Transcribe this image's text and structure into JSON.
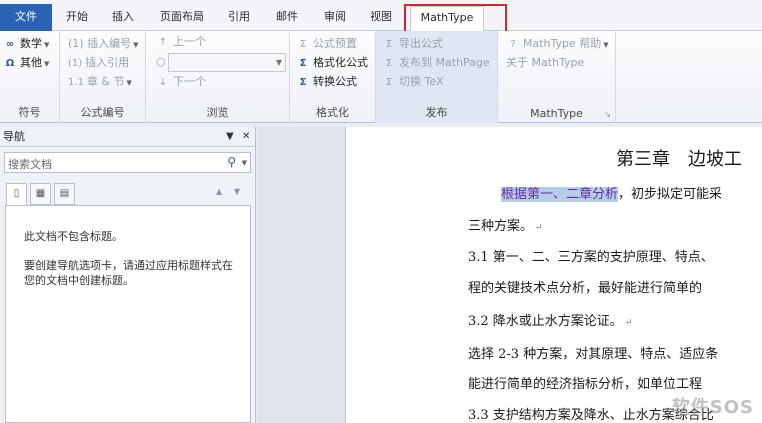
{
  "tabs": [
    {
      "label": "文件"
    },
    {
      "label": "开始"
    },
    {
      "label": "插入"
    },
    {
      "label": "页面布局"
    },
    {
      "label": "引用"
    },
    {
      "label": "邮件"
    },
    {
      "label": "审阅"
    },
    {
      "label": "视图"
    },
    {
      "label": "MathType"
    }
  ],
  "ribbon": {
    "symbols": {
      "label": "符号",
      "items": [
        {
          "label": "数学"
        },
        {
          "label": "其他"
        }
      ]
    },
    "numbering": {
      "label": "公式编号",
      "items": [
        {
          "label": "(1) 插入编号"
        },
        {
          "label": "插入引用"
        },
        {
          "label": "章 & 节"
        }
      ]
    },
    "browse": {
      "label": "浏览",
      "items": [
        {
          "label": "上一个"
        },
        {
          "label": "下一个"
        }
      ]
    },
    "format": {
      "label": "格式化",
      "items": [
        {
          "label": "公式预置"
        },
        {
          "label": "格式化公式"
        },
        {
          "label": "转换公式"
        }
      ]
    },
    "publish": {
      "label": "发布",
      "items": [
        {
          "label": "导出公式"
        },
        {
          "label": "发布到 MathPage"
        },
        {
          "label": "切换 TeX"
        }
      ]
    },
    "mathtype": {
      "label": "MathType",
      "items": [
        {
          "label": "MathType 帮助"
        },
        {
          "label": "关于 MathType"
        }
      ]
    }
  },
  "nav": {
    "title": "导航",
    "search_placeholder": "搜索文档",
    "msg1": "此文档不包含标题。",
    "msg2": "要创建导航选项卡，请通过应用标题样式在您的文档中创建标题。"
  },
  "doc": {
    "heading": "第三章　边坡工",
    "sel_text": "根据第一、二章分析",
    "line1_rest": "，初步拟定可能采",
    "line2": "三种方案。",
    "line3": "3.1  第一、二、三方案的支护原理、特点、",
    "line4": "程的关键技术点分析，最好能进行简单的",
    "line5": "3.2  降水或止水方案论证。",
    "line6": "选择 2-3 种方案，对其原理、特点、适应条",
    "line7": "能进行简单的经济指标分析，如单位工程",
    "line8": "3.3  支护结构方案及降水、止水方案综合比",
    "para_mark": "↵"
  },
  "watermark": "软件SOS"
}
